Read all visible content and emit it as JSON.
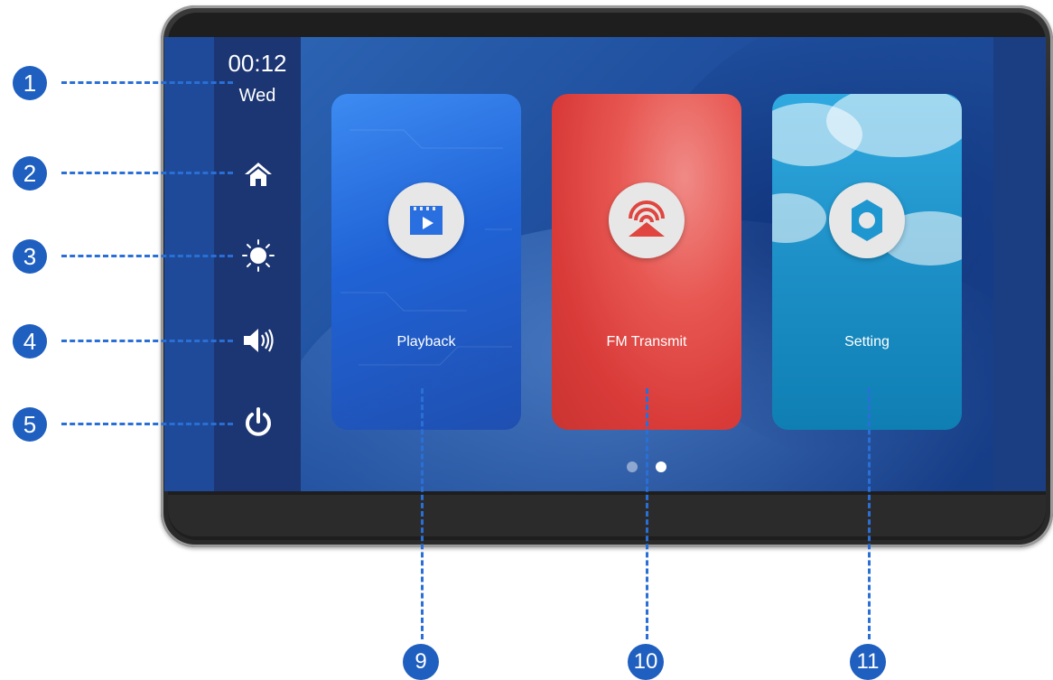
{
  "status": {
    "time": "00:12",
    "day": "Wed"
  },
  "sidebar": {
    "items": [
      {
        "icon": "home-icon"
      },
      {
        "icon": "brightness-icon"
      },
      {
        "icon": "volume-icon"
      },
      {
        "icon": "power-icon"
      }
    ]
  },
  "apps": [
    {
      "label": "Playback",
      "icon": "video-playback-icon",
      "color": "#2a6fe0"
    },
    {
      "label": "FM Transmit",
      "icon": "fm-antenna-icon",
      "color": "#e0453f"
    },
    {
      "label": "Setting",
      "icon": "settings-gear-icon",
      "color": "#1e96cf"
    }
  ],
  "pagination": {
    "pages": 2,
    "active": 2
  },
  "callouts": {
    "left": [
      "1",
      "2",
      "3",
      "4",
      "5"
    ],
    "bottom": [
      "9",
      "10",
      "11"
    ]
  },
  "colors": {
    "callout": "#1f5fbf",
    "screen": "#2058a8"
  }
}
